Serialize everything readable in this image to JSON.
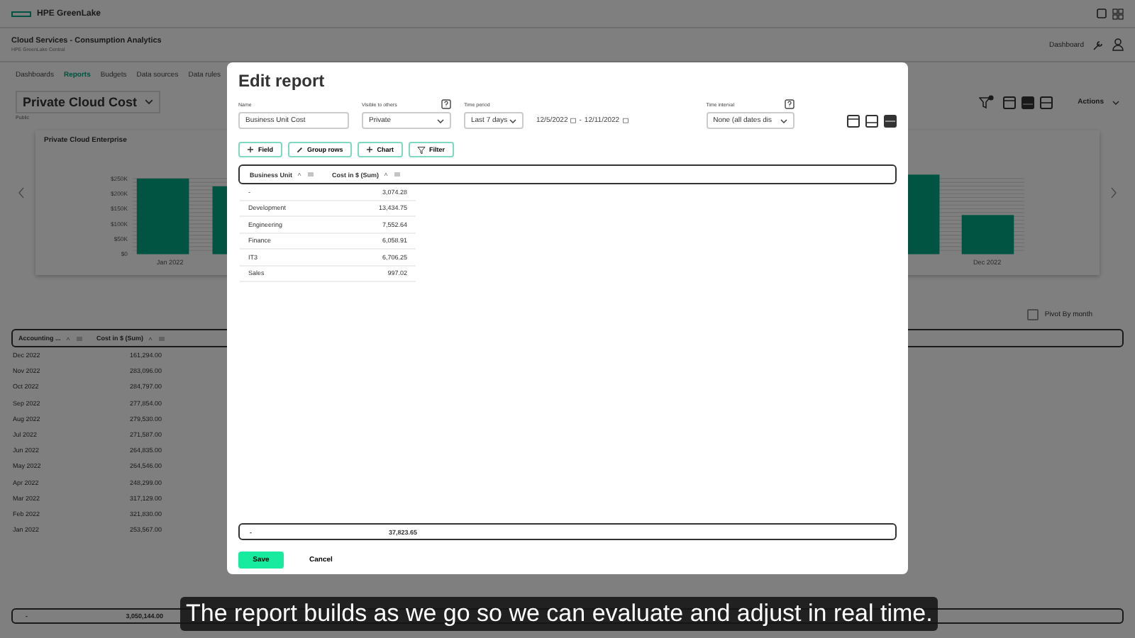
{
  "top_bar": {
    "brand": "HPE GreenLake"
  },
  "header": {
    "title": "Cloud Services - Consumption Analytics",
    "subtitle": "HPE GreenLake Central",
    "dashboard_link": "Dashboard"
  },
  "tabs": [
    {
      "label": "Dashboards",
      "selected": false
    },
    {
      "label": "Reports",
      "selected": true
    },
    {
      "label": "Budgets",
      "selected": false
    },
    {
      "label": "Data sources",
      "selected": false
    },
    {
      "label": "Data rules",
      "selected": false
    }
  ],
  "report": {
    "title": "Private Cloud Cost",
    "visibility": "Public",
    "actions": "Actions",
    "view_modes": [
      {
        "selected": false
      },
      {
        "selected": true
      },
      {
        "selected": false
      }
    ]
  },
  "chart": {
    "title": "Private Cloud Enterprise",
    "y_labels": [
      "$250K",
      "$200K",
      "$150K",
      "$100K",
      "$50K",
      "$0"
    ],
    "x_labels": [
      "Jan 2022",
      "Dec 2022"
    ]
  },
  "pivot": {
    "label": "Pivot By month",
    "checked": false
  },
  "table": {
    "columns": [
      "Accounting ...",
      "Cost in $ (Sum)"
    ],
    "rows": [
      [
        "Dec 2022",
        "161,294.00"
      ],
      [
        "Nov 2022",
        "283,096.00"
      ],
      [
        "Oct 2022",
        "284,797.00"
      ],
      [
        "Sep 2022",
        "277,854.00"
      ],
      [
        "Aug 2022",
        "279,530.00"
      ],
      [
        "Jul 2022",
        "271,587.00"
      ],
      [
        "Jun 2022",
        "264,835.00"
      ],
      [
        "May 2022",
        "264,546.00"
      ],
      [
        "Apr 2022",
        "248,299.00"
      ],
      [
        "Mar 2022",
        "317,129.00"
      ],
      [
        "Feb 2022",
        "321,830.00"
      ],
      [
        "Jan 2022",
        "253,567.00"
      ]
    ],
    "total": [
      "-",
      "3,050,144.00"
    ]
  },
  "dialog": {
    "title": "Edit report",
    "fields": [
      {
        "kind": "text",
        "label": "Name",
        "value": "Business Unit Cost"
      },
      {
        "kind": "select",
        "label": "Visible to others",
        "value": "Private",
        "help": true
      },
      {
        "kind": "select",
        "label": "Time period",
        "value": "Last 7 days"
      },
      {
        "kind": "dates",
        "start": "12/5/2022",
        "separator": "-",
        "end": "12/11/2022"
      },
      {
        "kind": "select",
        "label": "Time interval",
        "value": "None (all dates dis",
        "help": true
      }
    ],
    "view_modes": [
      {
        "selected": false
      },
      {
        "selected": false
      },
      {
        "selected": true
      }
    ],
    "tools": [
      {
        "kind": "plus",
        "label": "Field"
      },
      {
        "kind": "pen",
        "label": "Group rows"
      },
      {
        "kind": "plus",
        "label": "Chart"
      },
      {
        "kind": "filter",
        "label": "Filter"
      }
    ],
    "table": {
      "columns": [
        "Business Unit",
        "Cost in $ (Sum)"
      ],
      "rows": [
        [
          "-",
          "3,074.28"
        ],
        [
          "Development",
          "13,434.75"
        ],
        [
          "Engineering",
          "7,552.64"
        ],
        [
          "Finance",
          "6,058.91"
        ],
        [
          "IT3",
          "6,706.25"
        ],
        [
          "Sales",
          "997.02"
        ]
      ],
      "total": [
        "-",
        "37,823.65"
      ]
    },
    "buttons": [
      {
        "kind": "primary",
        "label": "Save"
      },
      {
        "kind": "plain",
        "label": "Cancel"
      }
    ]
  },
  "caption": "The report builds as we go so we can evaluate and adjust in real time."
}
